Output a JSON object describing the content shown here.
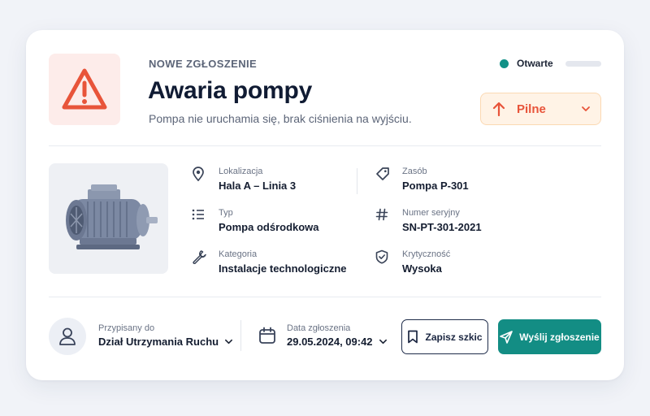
{
  "header": {
    "eyebrow": "NOWE ZGŁOSZENIE",
    "title": "Awaria pompy",
    "subtitle": "Pompa nie uruchamia się, brak ciśnienia na wyjściu."
  },
  "status": {
    "label": "Otwarte",
    "color": "#119187"
  },
  "priority": {
    "label": "Pilne",
    "color": "#e8543a"
  },
  "details": {
    "location": {
      "label": "Lokalizacja",
      "value": "Hala A – Linia 3",
      "icon": "map-pin-icon"
    },
    "asset": {
      "label": "Zasób",
      "value": "Pompa P-301",
      "icon": "tag-icon"
    },
    "type": {
      "label": "Typ",
      "value": "Pompa odśrodkowa",
      "icon": "list-icon"
    },
    "serial": {
      "label": "Numer seryjny",
      "value": "SN-PT-301-2021",
      "icon": "hash-icon"
    },
    "category": {
      "label": "Kategoria",
      "value": "Instalacje technologiczne",
      "icon": "wrench-icon"
    },
    "criticality": {
      "label": "Krytyczność",
      "value": "Wysoka",
      "icon": "shield-check-icon"
    }
  },
  "footer": {
    "assigned_label": "Przypisany do",
    "assigned_value": "Dział Utrzymania Ruchu",
    "date_label": "Data zgłoszenia",
    "date_value": "29.05.2024, 09:42",
    "draft_button": "Zapisz szkic",
    "send_button": "Wyślij zgłoszenie"
  },
  "colors": {
    "accent": "#138d84",
    "danger": "#e8543a",
    "warning_bg": "#fff3e6"
  }
}
